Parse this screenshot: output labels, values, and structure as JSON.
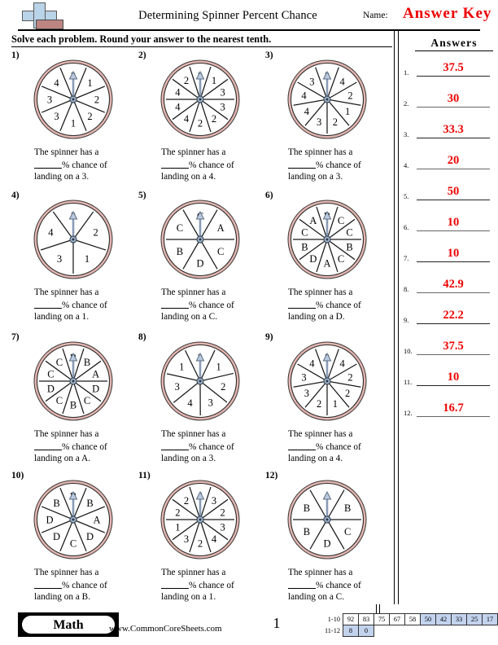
{
  "header": {
    "title": "Determining Spinner Percent Chance",
    "name_label": "Name:",
    "answer_key": "Answer Key",
    "logo_icon": "plus-book-logo"
  },
  "instructions": "Solve each problem. Round your answer to the nearest tenth.",
  "answers_panel": {
    "title": "Answers",
    "rows": [
      {
        "num": "1.",
        "value": "37.5"
      },
      {
        "num": "2.",
        "value": "30"
      },
      {
        "num": "3.",
        "value": "33.3"
      },
      {
        "num": "4.",
        "value": "20"
      },
      {
        "num": "5.",
        "value": "50"
      },
      {
        "num": "6.",
        "value": "10"
      },
      {
        "num": "7.",
        "value": "10"
      },
      {
        "num": "8.",
        "value": "42.9"
      },
      {
        "num": "9.",
        "value": "22.2"
      },
      {
        "num": "10.",
        "value": "37.5"
      },
      {
        "num": "11.",
        "value": "10"
      },
      {
        "num": "12.",
        "value": "16.7"
      }
    ],
    "answer_color": "#ee0000"
  },
  "problems": [
    {
      "num": "1)",
      "target": "3",
      "text_line1": "The spinner has a",
      "text_line2_suffix": "% chance of",
      "text_line3": "landing on a 3.",
      "sectors": [
        "3",
        "1",
        "2",
        "2",
        "1",
        "3",
        "3",
        "4"
      ],
      "start_angle": -22.5
    },
    {
      "num": "2)",
      "target": "4",
      "text_line1": "The spinner has a",
      "text_line2_suffix": "% chance of",
      "text_line3": "landing on a 4.",
      "sectors": [
        "2",
        "1",
        "3",
        "3",
        "2",
        "2",
        "4",
        "4",
        "4",
        "2"
      ],
      "start_angle": -18
    },
    {
      "num": "3)",
      "target": "3",
      "text_line1": "The spinner has a",
      "text_line2_suffix": "% chance of",
      "text_line3": "landing on a 3.",
      "sectors": [
        "3",
        "4",
        "2",
        "1",
        "2",
        "3",
        "4",
        "4",
        "3"
      ],
      "start_angle": -20
    },
    {
      "num": "4)",
      "target": "1",
      "text_line1": "The spinner has a",
      "text_line2_suffix": "% chance of",
      "text_line3": "landing on a 1.",
      "sectors": [
        "3",
        "2",
        "1",
        "3",
        "4"
      ],
      "start_angle": -36
    },
    {
      "num": "5)",
      "target": "C",
      "text_line1": "The spinner has a",
      "text_line2_suffix": "% chance of",
      "text_line3": "landing on a C.",
      "sectors": [
        "C",
        "A",
        "C",
        "D",
        "B",
        "C"
      ],
      "start_angle": -30
    },
    {
      "num": "6)",
      "target": "D",
      "text_line1": "The spinner has a",
      "text_line2_suffix": "% chance of",
      "text_line3": "landing on a D.",
      "sectors": [
        "B",
        "C",
        "C",
        "B",
        "C",
        "A",
        "D",
        "B",
        "C",
        "A"
      ],
      "start_angle": -18
    },
    {
      "num": "7)",
      "target": "A",
      "text_line1": "The spinner has a",
      "text_line2_suffix": "% chance of",
      "text_line3": "landing on a A.",
      "sectors": [
        "B",
        "B",
        "A",
        "D",
        "C",
        "B",
        "C",
        "D",
        "C",
        "C"
      ],
      "start_angle": -18
    },
    {
      "num": "8)",
      "target": "3",
      "text_line1": "The spinner has a",
      "text_line2_suffix": "% chance of",
      "text_line3": "landing on a 3.",
      "sectors": [
        "3",
        "1",
        "2",
        "3",
        "4",
        "3",
        "1"
      ],
      "start_angle": -26
    },
    {
      "num": "9)",
      "target": "4",
      "text_line1": "The spinner has a",
      "text_line2_suffix": "% chance of",
      "text_line3": "landing on a 4.",
      "sectors": [
        "3",
        "4",
        "2",
        "2",
        "1",
        "2",
        "3",
        "3",
        "4"
      ],
      "start_angle": -20
    },
    {
      "num": "10)",
      "target": "B",
      "text_line1": "The spinner has a",
      "text_line2_suffix": "% chance of",
      "text_line3": "landing on a B.",
      "sectors": [
        "B",
        "B",
        "A",
        "D",
        "C",
        "D",
        "D",
        "B"
      ],
      "start_angle": -22.5
    },
    {
      "num": "11)",
      "target": "1",
      "text_line1": "The spinner has a",
      "text_line2_suffix": "% chance of",
      "text_line3": "landing on a 1.",
      "sectors": [
        "4",
        "3",
        "2",
        "3",
        "4",
        "2",
        "3",
        "1",
        "2",
        "2"
      ],
      "start_angle": -18
    },
    {
      "num": "12)",
      "target": "C",
      "text_line1": "The spinner has a",
      "text_line2_suffix": "% chance of",
      "text_line3": "landing on a C.",
      "sectors": [
        "A",
        "B",
        "C",
        "D",
        "B",
        "B"
      ],
      "start_angle": -30
    }
  ],
  "footer": {
    "math_label": "Math",
    "site": "www.CommonCoreSheets.com",
    "page_number": "1",
    "grading": {
      "row1_label": "1-10",
      "row2_label": "11-12",
      "row1": [
        "92",
        "83",
        "75",
        "67",
        "58",
        "50",
        "42",
        "33",
        "25",
        "17"
      ],
      "row1_highlight": [
        false,
        false,
        false,
        false,
        false,
        true,
        true,
        true,
        true,
        true
      ],
      "row2": [
        "8",
        "0"
      ],
      "row2_highlight": [
        true,
        true
      ]
    }
  },
  "colors": {
    "answer_red": "#ee0000",
    "spinner_rim": "#e3b5b0",
    "highlight": "#c3d3ee"
  }
}
